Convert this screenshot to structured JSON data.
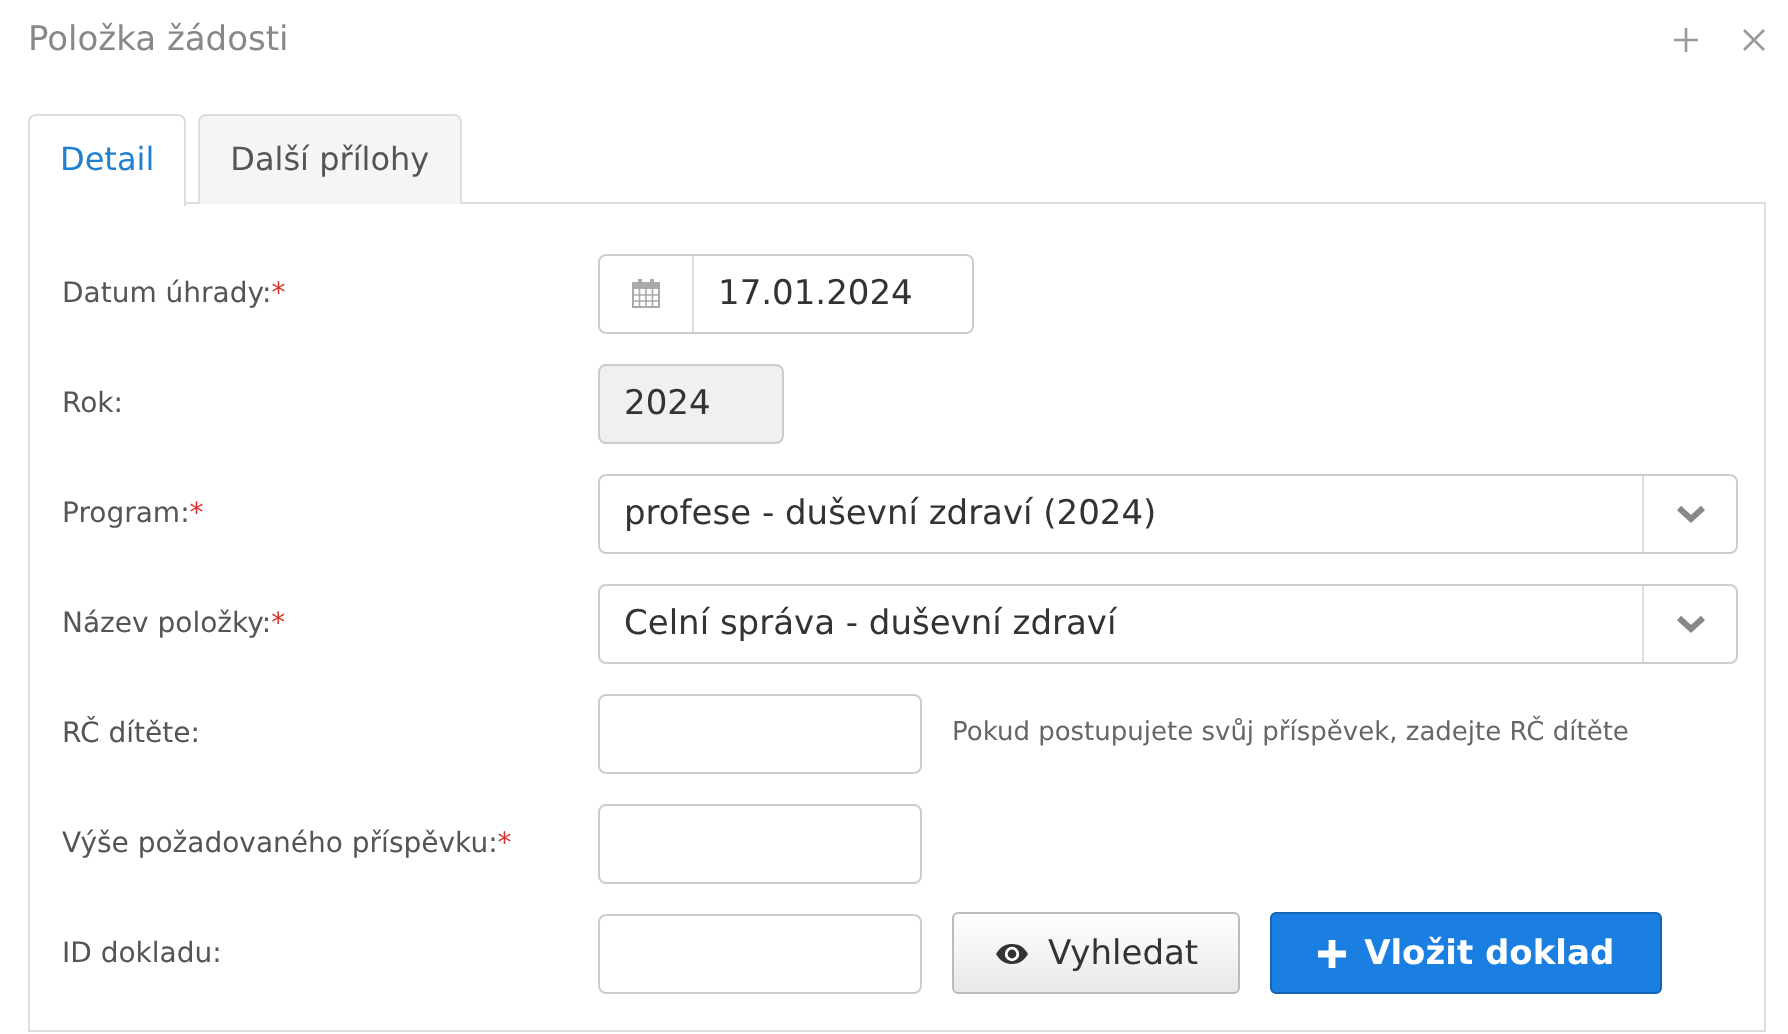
{
  "window": {
    "title": "Položka žádosti"
  },
  "tabs": [
    {
      "label": "Detail",
      "selected": true
    },
    {
      "label": "Další přílohy",
      "selected": false
    }
  ],
  "fields": [
    {
      "kind": "date",
      "label": "Datum úhrady:",
      "required_mark": "*",
      "value": "17.01.2024",
      "disabled": false
    },
    {
      "kind": "text",
      "label": "Rok:",
      "value": "2024",
      "disabled": true
    },
    {
      "kind": "select",
      "label": "Program:",
      "required_mark": "*",
      "value": "profese - duševní zdraví (2024)",
      "disabled": false
    },
    {
      "kind": "select",
      "label": "Název položky:",
      "required_mark": "*",
      "value": "Celní správa - duševní zdraví",
      "disabled": false
    },
    {
      "kind": "text",
      "label": "RČ dítěte:",
      "hint": "Pokud postupujete svůj příspěvek, zadejte RČ dítěte",
      "disabled": false
    },
    {
      "kind": "text",
      "label": "Výše požadovaného příspěvku:",
      "required_mark": "*",
      "disabled": false
    },
    {
      "kind": "text",
      "label": "ID dokladu:",
      "disabled": false,
      "buttons": [
        {
          "kind": "default",
          "label": "Vyhledat"
        },
        {
          "kind": "primary",
          "label": "Vložit doklad"
        }
      ]
    }
  ]
}
